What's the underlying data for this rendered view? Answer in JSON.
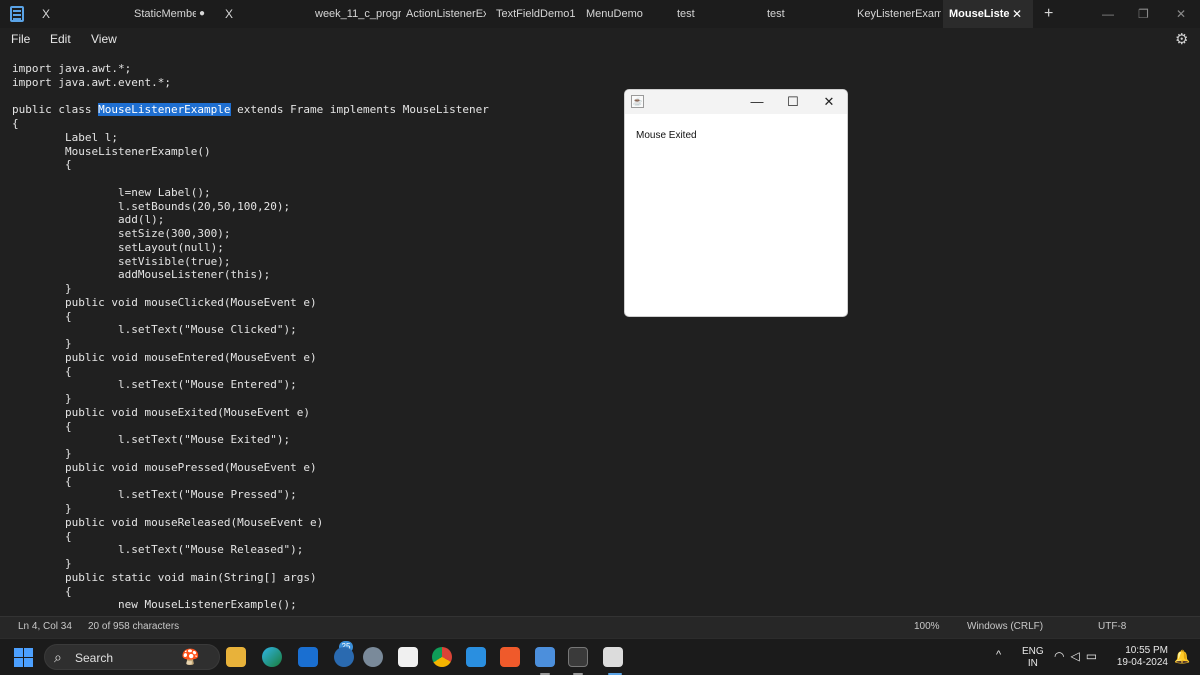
{
  "tabs": [
    {
      "label": "X",
      "left": 0
    },
    {
      "label": "StaticMembe",
      "modified": true
    },
    {
      "label": "X"
    },
    {
      "label": "week_11_c_prograi"
    },
    {
      "label": "ActionListenerExa"
    },
    {
      "label": "TextFieldDemo1"
    },
    {
      "label": "MenuDemo"
    },
    {
      "label": "test"
    },
    {
      "label": "test"
    },
    {
      "label": "KeyListenerExamp"
    },
    {
      "label": "MouseListe",
      "active": true
    }
  ],
  "tab_close_glyph": "X",
  "active_tab_close": "✕",
  "modified_dot": "●",
  "new_tab": "+",
  "window_controls": {
    "minimize": "—",
    "restore": "❐",
    "close": "✕"
  },
  "menu": {
    "file": "File",
    "edit": "Edit",
    "view": "View"
  },
  "code_lines": [
    "import java.awt.*;",
    "import java.awt.event.*;",
    "",
    "public class |MouseListenerExample| extends Frame implements MouseListener",
    "{",
    "        Label l;",
    "        MouseListenerExample()",
    "        {",
    "",
    "                l=new Label();",
    "                l.setBounds(20,50,100,20);",
    "                add(l);",
    "                setSize(300,300);",
    "                setLayout(null);",
    "                setVisible(true);",
    "                addMouseListener(this);",
    "        }",
    "        public void mouseClicked(MouseEvent e)",
    "        {",
    "                l.setText(\"Mouse Clicked\");",
    "        }",
    "        public void mouseEntered(MouseEvent e)",
    "        {",
    "                l.setText(\"Mouse Entered\");",
    "        }",
    "        public void mouseExited(MouseEvent e)",
    "        {",
    "                l.setText(\"Mouse Exited\");",
    "        }",
    "        public void mousePressed(MouseEvent e)",
    "        {",
    "                l.setText(\"Mouse Pressed\");",
    "        }",
    "        public void mouseReleased(MouseEvent e)",
    "        {",
    "                l.setText(\"Mouse Released\");",
    "        }",
    "        public static void main(String[] args)",
    "        {",
    "                new MouseListenerExample();"
  ],
  "frame": {
    "label_text": "Mouse Exited",
    "minimize": "—",
    "maximize": "☐",
    "close": "✕"
  },
  "status": {
    "position": "Ln 4, Col 34",
    "selection": "20 of 958 characters",
    "zoom": "100%",
    "line_ending": "Windows (CRLF)",
    "encoding": "UTF-8"
  },
  "taskbar": {
    "search_placeholder": "Search",
    "badge_count": "25",
    "lang_top": "ENG",
    "lang_bottom": "IN",
    "time": "10:55 PM",
    "date": "19-04-2024"
  },
  "colors": {
    "editor_bg": "#202020",
    "selection": "#1f6fd1",
    "start_blue": "#4ca0ff"
  }
}
